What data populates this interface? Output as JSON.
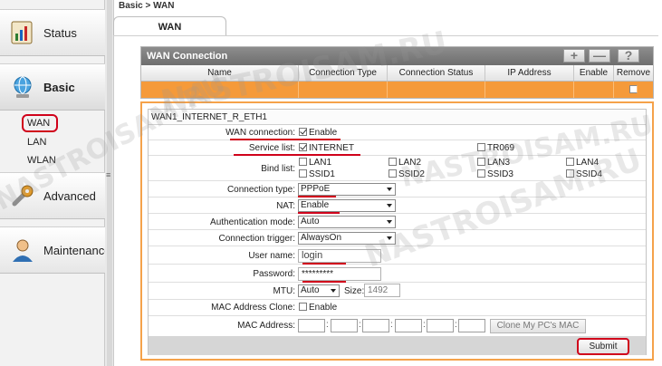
{
  "sidebar": {
    "items": [
      {
        "label": "Status",
        "icon": "status-chart-icon"
      },
      {
        "label": "Basic",
        "icon": "basic-globe-icon"
      },
      {
        "label": "Advanced",
        "icon": "advanced-wrench-icon"
      },
      {
        "label": "Maintenance",
        "icon": "maintenance-user-icon"
      }
    ],
    "sub_items": [
      "WAN",
      "LAN",
      "WLAN"
    ],
    "grip": "≡"
  },
  "breadcrumb": "Basic > WAN",
  "tab": {
    "label": "WAN"
  },
  "wan_connection": {
    "title": "WAN Connection",
    "buttons": [
      "+",
      "—",
      "?"
    ],
    "columns": [
      "Name",
      "Connection Type",
      "Connection Status",
      "IP Address",
      "Enable",
      "Remove"
    ]
  },
  "form": {
    "title": "WAN1_INTERNET_R_ETH1",
    "wan_connection_label": "WAN connection:",
    "wan_connection_value": "Enable",
    "service_list_label": "Service list:",
    "service_internet": "INTERNET",
    "service_tr069": "TR069",
    "bind_list_label": "Bind list:",
    "bind_items": [
      "LAN1",
      "LAN2",
      "LAN3",
      "LAN4",
      "SSID1",
      "SSID2",
      "SSID3",
      "SSID4"
    ],
    "connection_type_label": "Connection type:",
    "connection_type_value": "PPPoE",
    "nat_label": "NAT:",
    "nat_value": "Enable",
    "auth_mode_label": "Authentication mode:",
    "auth_mode_value": "Auto",
    "conn_trigger_label": "Connection trigger:",
    "conn_trigger_value": "AlwaysOn",
    "username_label": "User name:",
    "username_value": "login",
    "password_label": "Password:",
    "password_value": "*********",
    "mtu_label": "MTU:",
    "mtu_value": "Auto",
    "size_label": "Size:",
    "size_value": "1492",
    "mac_clone_label": "MAC Address Clone:",
    "mac_clone_value": "Enable",
    "mac_address_label": "MAC Address:",
    "mac_separator": ":",
    "clone_button": "Clone My PC's MAC",
    "submit": "Submit"
  },
  "watermark": "NASTROISAM.RU",
  "colors": {
    "accent_orange": "#f59a3a",
    "highlight_red": "#d0021b",
    "header_gray": "#7a7a7a"
  }
}
